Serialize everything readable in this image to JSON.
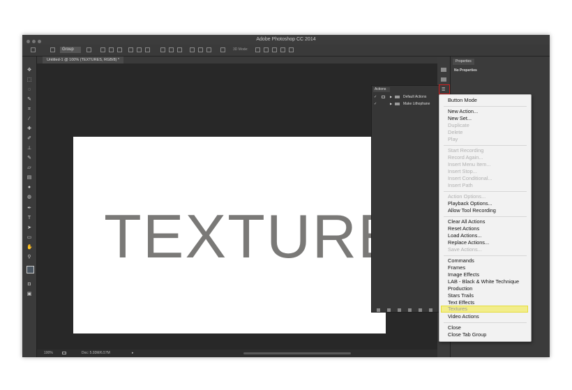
{
  "window": {
    "title": "Adobe Photoshop CC 2014"
  },
  "options_bar": {
    "select_value": "Group",
    "mode_label": "3D Mode:"
  },
  "document": {
    "tab_label": "Untitled-1 @ 100% (TEXTURES, RGB/8) *",
    "canvas_text": "TEXTURES"
  },
  "status": {
    "zoom": "100%",
    "doc_info": "Doc: 5.93M/6.57M"
  },
  "properties_panel": {
    "tab_label": "Properties",
    "body_text": "No Properties"
  },
  "actions_panel": {
    "tab_label": "Actions",
    "sets": [
      {
        "label": "Default Actions"
      },
      {
        "label": "Make Lithophane"
      }
    ]
  },
  "panel_menu": {
    "items": [
      {
        "label": "Button Mode",
        "enabled": true
      },
      {
        "label": "New Action...",
        "enabled": true
      },
      {
        "label": "New Set...",
        "enabled": true
      },
      {
        "label": "Duplicate",
        "enabled": false
      },
      {
        "label": "Delete",
        "enabled": false
      },
      {
        "label": "Play",
        "enabled": false
      },
      {
        "label": "Start Recording",
        "enabled": false
      },
      {
        "label": "Record Again...",
        "enabled": false
      },
      {
        "label": "Insert Menu Item...",
        "enabled": false
      },
      {
        "label": "Insert Stop...",
        "enabled": false
      },
      {
        "label": "Insert Conditional...",
        "enabled": false
      },
      {
        "label": "Insert Path",
        "enabled": false
      },
      {
        "label": "Action Options...",
        "enabled": false
      },
      {
        "label": "Playback Options...",
        "enabled": true
      },
      {
        "label": "Allow Tool Recording",
        "enabled": true
      },
      {
        "label": "Clear All Actions",
        "enabled": true
      },
      {
        "label": "Reset Actions",
        "enabled": true
      },
      {
        "label": "Load Actions...",
        "enabled": true
      },
      {
        "label": "Replace Actions...",
        "enabled": true
      },
      {
        "label": "Save Actions...",
        "enabled": false
      },
      {
        "label": "Commands",
        "enabled": true
      },
      {
        "label": "Frames",
        "enabled": true
      },
      {
        "label": "Image Effects",
        "enabled": true
      },
      {
        "label": "LAB - Black & White Technique",
        "enabled": true
      },
      {
        "label": "Production",
        "enabled": true
      },
      {
        "label": "Stars Trails",
        "enabled": true
      },
      {
        "label": "Text Effects",
        "enabled": true
      },
      {
        "label": "Textures",
        "enabled": true,
        "highlighted": true
      },
      {
        "label": "Video Actions",
        "enabled": true
      },
      {
        "label": "Close",
        "enabled": true
      },
      {
        "label": "Close Tab Group",
        "enabled": true
      }
    ]
  },
  "colors": {
    "highlight": "#f2ed8a",
    "highlight_border": "#e5dc3a",
    "menu_button_border": "#d02020",
    "canvas_text": "#7a7977"
  },
  "icons": [
    "move-tool-icon",
    "marquee-tool-icon",
    "lasso-tool-icon",
    "quick-select-icon",
    "crop-tool-icon",
    "eyedropper-icon",
    "healing-brush-icon",
    "brush-tool-icon",
    "clone-stamp-icon",
    "history-brush-icon",
    "eraser-icon",
    "gradient-icon",
    "blur-icon",
    "dodge-icon",
    "pen-tool-icon",
    "type-tool-icon",
    "path-select-icon",
    "shape-tool-icon",
    "hand-tool-icon",
    "zoom-tool-icon",
    "folder-icon",
    "panel-menu-icon"
  ]
}
